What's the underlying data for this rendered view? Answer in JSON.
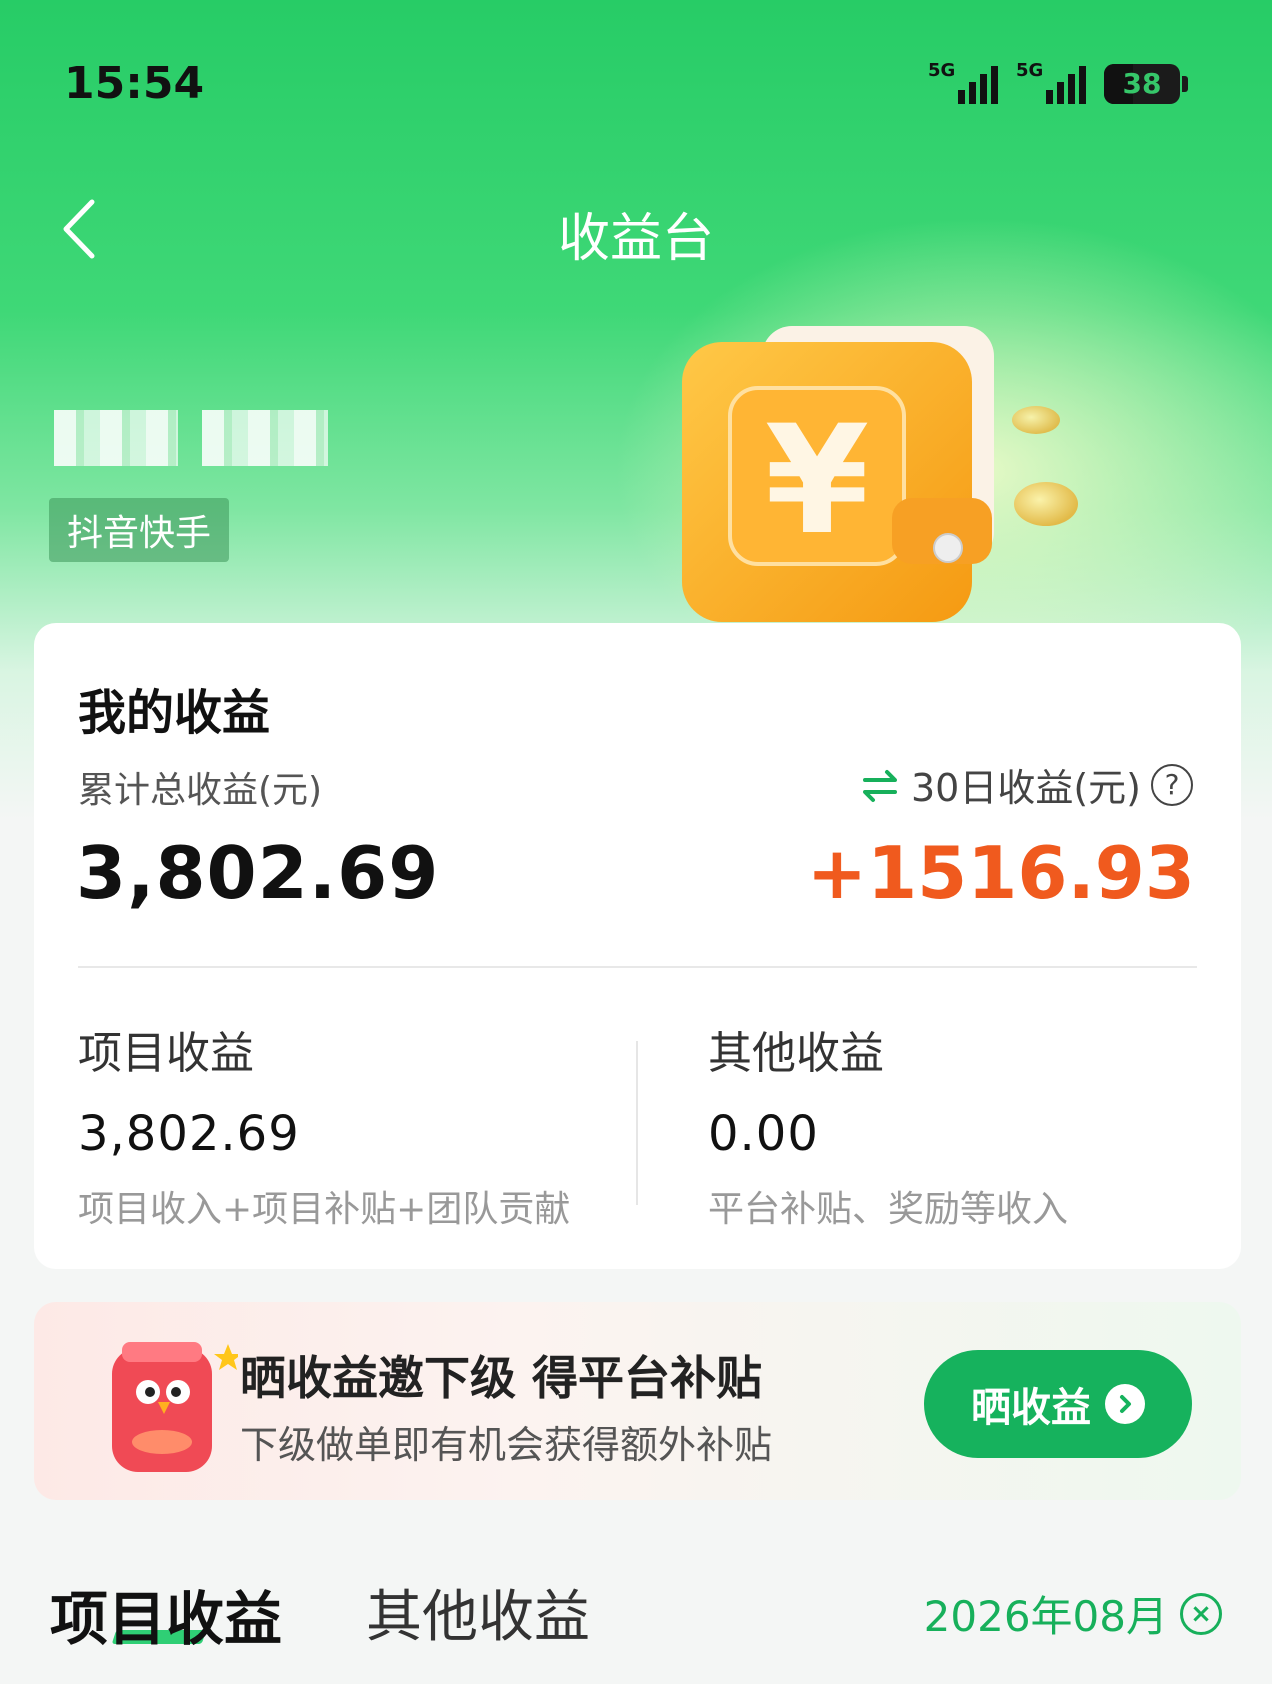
{
  "status_bar": {
    "time": "15:54",
    "signal1_label": "5G",
    "signal2_label": "5G",
    "battery": "38"
  },
  "nav": {
    "title": "收益台",
    "back_icon": "chevron-left-icon"
  },
  "user": {
    "tag": "抖音快手"
  },
  "earnings": {
    "title": "我的收益",
    "total_label": "累计总收益(元)",
    "total_value": "3,802.69",
    "d30_label": "30日收益(元)",
    "d30_value": "+1516.93",
    "help_symbol": "?",
    "project": {
      "title": "项目收益",
      "value": "3,802.69",
      "desc": "项目收入+项目补贴+团队贡献"
    },
    "other": {
      "title": "其他收益",
      "value": "0.00",
      "desc": "平台补贴、奖励等收入"
    }
  },
  "promo": {
    "title": "晒收益邀下级 得平台补贴",
    "subtitle": "下级做单即有机会获得额外补贴",
    "button": "晒收益"
  },
  "tabs": {
    "active": "项目收益",
    "inactive": "其他收益",
    "month": "2026年08月"
  },
  "colors": {
    "brand_green": "#16b25d",
    "accent_orange": "#f05a1e"
  }
}
